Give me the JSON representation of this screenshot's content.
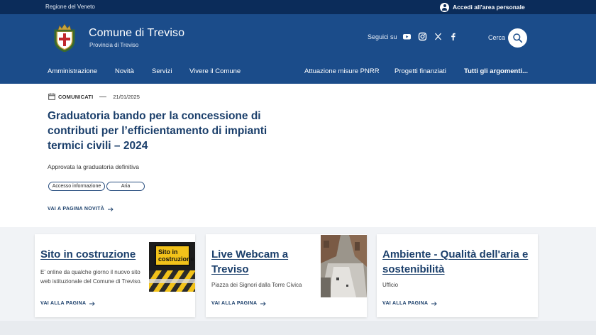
{
  "topbar": {
    "region": "Regione del Veneto",
    "login": "Accedi all'area personale"
  },
  "header": {
    "title": "Comune di Treviso",
    "subtitle": "Provincia di Treviso",
    "follow_label": "Seguici su",
    "search_label": "Cerca"
  },
  "nav": {
    "left": [
      "Amministrazione",
      "Novità",
      "Servizi",
      "Vivere il Comune"
    ],
    "right": [
      "Attuazione misure PNRR",
      "Progetti finanziati",
      "Tutti gli argomenti..."
    ]
  },
  "article": {
    "category": "COMUNICATI",
    "date": "21/01/2025",
    "title": "Graduatoria bando per la concessione di contributi per l’efficientamento di impianti termici civili – 2024",
    "summary": "Approvata la graduatoria definitiva",
    "tags": [
      "Accesso informazione",
      "Aria"
    ],
    "more_link": "VAI A PAGINA NOVITÀ"
  },
  "cards": [
    {
      "title": "Sito in costruzione",
      "text": "E' online da qualche giorno il nuovo sito web istituzionale del Comune di Treviso.",
      "link": "VAI ALLA PAGINA",
      "image_text": [
        "Sito in",
        "costruzione"
      ]
    },
    {
      "title": "Live Webcam a Treviso",
      "text": "Piazza dei Signori dalla Torre Civica",
      "link": "VAI ALLA PAGINA"
    },
    {
      "title": "Ambiente - Qualità dell'aria e sostenibilità",
      "text": "Ufficio",
      "link": "VAI ALLA PAGINA"
    }
  ],
  "colors": {
    "topbar": "#0b2c5a",
    "header": "#1b4c8a",
    "heading": "#1b3f6b"
  },
  "icons": [
    "user-icon",
    "youtube-icon",
    "instagram-icon",
    "x-icon",
    "facebook-icon",
    "search-icon",
    "calendar-icon",
    "arrow-right-icon"
  ]
}
